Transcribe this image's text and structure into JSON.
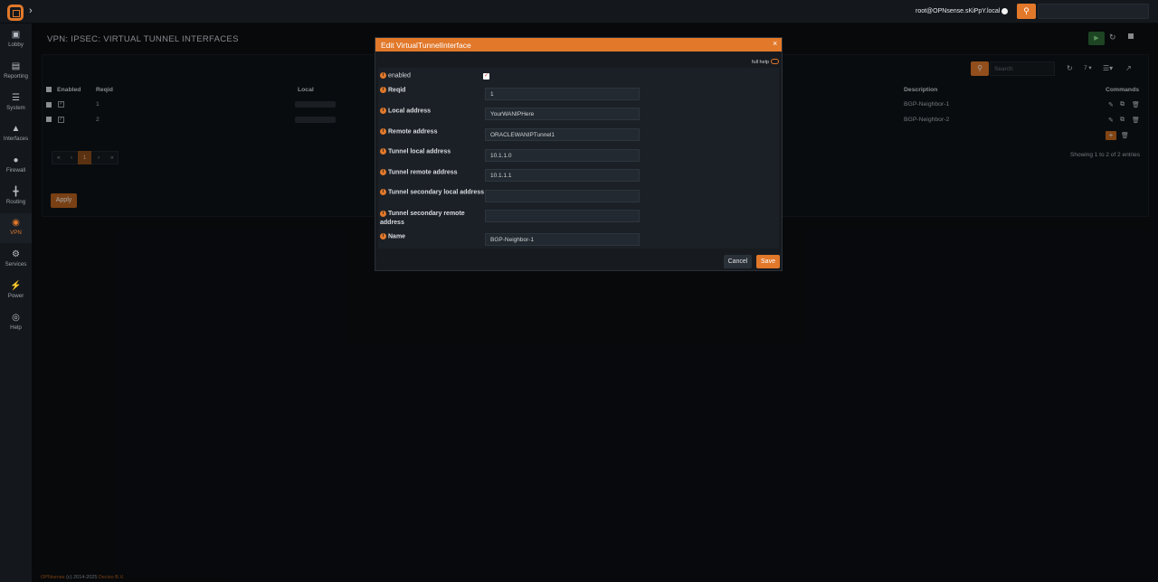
{
  "topbar": {
    "user": "root@OPNsense.sKiPpY.local",
    "search_icon": "search-icon",
    "expand_icon": "chevron-right-icon"
  },
  "sidebar": {
    "items": [
      {
        "label": "Lobby",
        "icon": "laptop-icon"
      },
      {
        "label": "Reporting",
        "icon": "area-chart-icon"
      },
      {
        "label": "System",
        "icon": "server-icon"
      },
      {
        "label": "Interfaces",
        "icon": "sitemap-icon"
      },
      {
        "label": "Firewall",
        "icon": "fire-icon"
      },
      {
        "label": "Routing",
        "icon": "signpost-icon"
      },
      {
        "label": "VPN",
        "icon": "globe-icon"
      },
      {
        "label": "Services",
        "icon": "cog-icon"
      },
      {
        "label": "Power",
        "icon": "plug-icon"
      },
      {
        "label": "Help",
        "icon": "lifebuoy-icon"
      }
    ],
    "active": "VPN"
  },
  "page": {
    "title": "VPN: IPSEC: VIRTUAL TUNNEL INTERFACES"
  },
  "table": {
    "search_placeholder": "Search",
    "page_size": "7",
    "columns": {
      "enabled": "Enabled",
      "reqid": "Reqid",
      "local": "Local",
      "description": "Description",
      "commands": "Commands"
    },
    "rows": [
      {
        "reqid": "1",
        "description": "BGP-Neighbor-1"
      },
      {
        "reqid": "2",
        "description": "BGP-Neighbor-2"
      }
    ],
    "pager": {
      "first": "«",
      "prev": "‹",
      "current": "1",
      "next": "›",
      "last": "»"
    },
    "showing": "Showing 1 to 2 of 2 entries"
  },
  "apply_label": "Apply",
  "footer": {
    "brand": "OPNsense",
    "copyright": "(c) 2014-2025",
    "company": "Deciso B.V."
  },
  "modal": {
    "title": "Edit VirtualTunnelInterface",
    "full_help": "full help",
    "fields": {
      "enabled": {
        "label": "enabled",
        "checked": true
      },
      "reqid": {
        "label": "Reqid",
        "value": "1"
      },
      "local_address": {
        "label": "Local address",
        "value": "YourWANIPHere"
      },
      "remote_address": {
        "label": "Remote address",
        "value": "ORACLEWANIPTunnel1"
      },
      "tunnel_local": {
        "label": "Tunnel local address",
        "value": "10.1.1.0"
      },
      "tunnel_remote": {
        "label": "Tunnel remote address",
        "value": "10.1.1.1"
      },
      "tunnel_sec_local": {
        "label": "Tunnel secondary local address",
        "value": ""
      },
      "tunnel_sec_remote": {
        "label": "Tunnel secondary remote address",
        "value": ""
      },
      "name": {
        "label": "Name",
        "value": "BGP-Neighbor-1"
      }
    },
    "cancel_label": "Cancel",
    "save_label": "Save"
  },
  "colors": {
    "accent": "#e1782a",
    "background": "#0b0e12",
    "sidebar": "#14181d"
  }
}
